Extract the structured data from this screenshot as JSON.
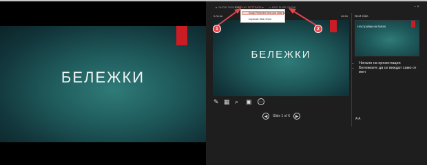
{
  "audience_view": {
    "slide_title": "БЕЛЕЖКИ"
  },
  "toolbar": {
    "show_taskbar": "SHOW TASKBAR",
    "display_settings": "DISPLAY SETTINGS ▾",
    "end_slide_show": "END SLIDE SHOW"
  },
  "display_menu": {
    "items": [
      "Swap Presenter View and Slide Show",
      "Duplicate Slide Show"
    ]
  },
  "presenter": {
    "timer": "0:00:06",
    "clock": "08:59",
    "current_slide_title": "БЕЛЕЖКИ",
    "next_slide_label": "Next slide",
    "next_slide_title": "Настройки на Notes",
    "notes": [
      "Начало на презентация",
      "Бележките да се виждат само от мен"
    ],
    "slide_counter": "Slide 1 of 6",
    "font_size_icons": "A A"
  },
  "callouts": [
    "1",
    "2"
  ],
  "colors": {
    "accent_red": "#c91c24",
    "callout_red": "#e2474e",
    "slide_teal": "#1f5a5b"
  }
}
